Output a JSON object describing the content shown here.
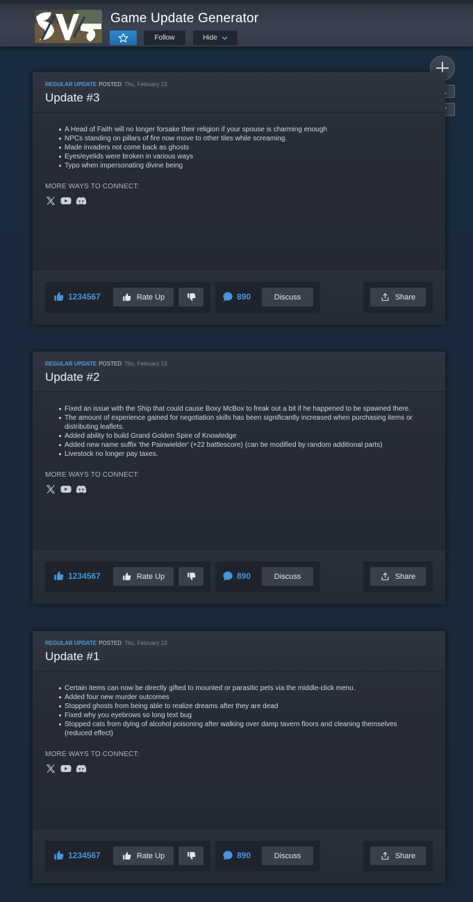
{
  "header": {
    "app_title": "Game Update Generator",
    "follow_label": "Follow",
    "hide_label": "Hide",
    "icons": [
      "star-icon",
      "chevron-down-icon",
      "plus-icon",
      "arrow-up-icon",
      "arrow-down-icon"
    ]
  },
  "colors": {
    "accent_blue": "#4596e0",
    "type_label": "#4c9de2",
    "star_button": "#1a6ea9",
    "background": "#1b2838"
  },
  "posts": [
    {
      "type": "REGULAR UPDATE",
      "posted_label": "POSTED",
      "date": "Thu, February 13",
      "title": "Update #3",
      "notes": [
        "A Head of Faith will no longer forsake their religion if your spouse is charming enough",
        "NPCs standing on pillars of fire now move to other tiles while screaming.",
        "Made invaders not come back as ghosts",
        "Eyes/eyelids were broken in various ways",
        "Typo when impersonating divine being"
      ],
      "connect_label": "MORE WAYS TO CONNECT:",
      "socials": [
        "x-icon",
        "youtube-icon",
        "discord-icon"
      ],
      "votes": "1234567",
      "rate_up_label": "Rate Up",
      "comments": "890",
      "discuss_label": "Discuss",
      "share_label": "Share"
    },
    {
      "type": "REGULAR UPDATE",
      "posted_label": "POSTED",
      "date": "Thu, February 13",
      "title": "Update #2",
      "notes": [
        "Fixed an issue with the Ship that could cause Boxy McBox to freak out a bit if he happened to be spawned there.",
        "The amount of experience gained for negotiation skills has been significantly increased when purchasing items or distributing leaflets.",
        "Added ability to build Grand Golden Spire of Knowledge",
        "Added new name suffix 'the Painwielder' (+22 battlescore) (can be modified by random additional parts)",
        "Livestock no longer pay taxes."
      ],
      "connect_label": "MORE WAYS TO CONNECT:",
      "socials": [
        "x-icon",
        "youtube-icon",
        "discord-icon"
      ],
      "votes": "1234567",
      "rate_up_label": "Rate Up",
      "comments": "890",
      "discuss_label": "Discuss",
      "share_label": "Share"
    },
    {
      "type": "REGULAR UPDATE",
      "posted_label": "POSTED",
      "date": "Thu, February 13",
      "title": "Update #1",
      "notes": [
        "Certain items can now be directly gifted to mounted or parasitic pets via the middle-click menu.",
        "Added four new murder outcomes",
        "Stopped ghosts from being able to realize dreams after they are dead",
        "Fixed why you eyebrows so long text bug",
        "Stopped cats from dying of alcohol poisoning after walking over damp tavern floors and cleaning themselves (reduced effect)"
      ],
      "connect_label": "MORE WAYS TO CONNECT:",
      "socials": [
        "x-icon",
        "youtube-icon",
        "discord-icon"
      ],
      "votes": "1234567",
      "rate_up_label": "Rate Up",
      "comments": "890",
      "discuss_label": "Discuss",
      "share_label": "Share"
    }
  ]
}
